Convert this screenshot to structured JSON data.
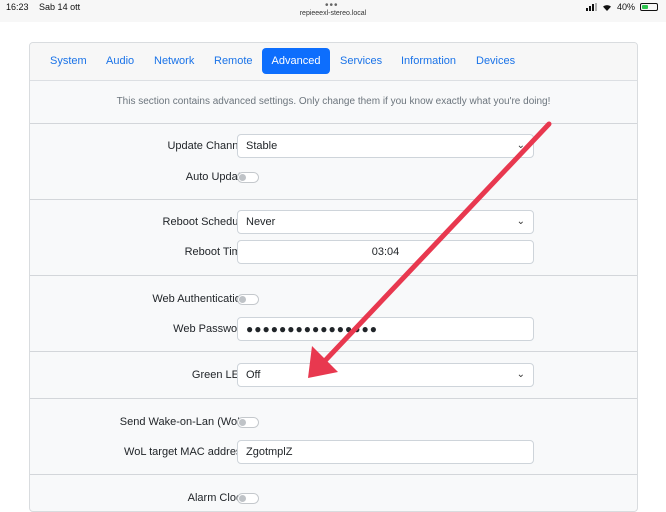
{
  "status_bar": {
    "time": "16:23",
    "date": "Sab 14 ott",
    "url": "repieeexl-stereo.local",
    "battery": "40%",
    "battery_level": 0.4
  },
  "tabs": [
    "System",
    "Audio",
    "Network",
    "Remote",
    "Advanced",
    "Services",
    "Information",
    "Devices"
  ],
  "active_tab": "Advanced",
  "intro": "This section contains advanced settings. Only change them if you know exactly what you're doing!",
  "settings": {
    "update_channel": {
      "label": "Update Channel:",
      "value": "Stable"
    },
    "auto_update": {
      "label": "Auto Update:",
      "on": false
    },
    "reboot_schedule": {
      "label": "Reboot Schedule:",
      "value": "Never"
    },
    "reboot_time": {
      "label": "Reboot Time:",
      "value": "03:04"
    },
    "web_auth": {
      "label": "Web Authentication:",
      "on": false
    },
    "web_password": {
      "label": "Web Password:",
      "value": "●●●●●●●●●●●●●●●●"
    },
    "green_led": {
      "label": "Green LED:",
      "value": "Off"
    },
    "wol": {
      "label": "Send Wake-on-Lan (WoL):",
      "on": false
    },
    "wol_mac": {
      "label": "WoL target MAC address:",
      "value": "ZgotmplZ"
    },
    "alarm_clock": {
      "label": "Alarm Clock:",
      "on": false
    }
  },
  "icons": {
    "chevron": "chevron-down-icon",
    "annotation_arrow": "red-arrow-annotation",
    "arrow_color": "#e8384f"
  }
}
